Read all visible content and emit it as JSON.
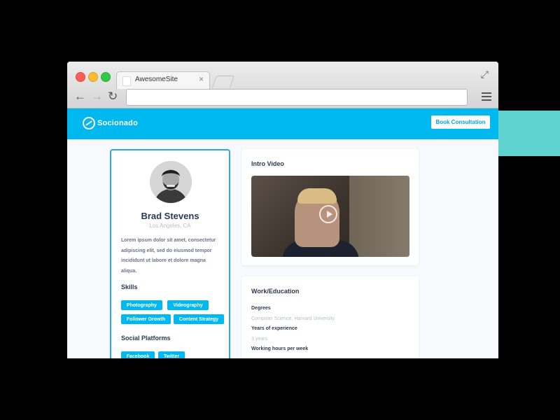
{
  "browser": {
    "tab_title": "AwesomeSite",
    "tab_close": "×",
    "address": ""
  },
  "header": {
    "brand": "Socionado",
    "cta": "Book Consultation",
    "bg_color": "#00b8f0"
  },
  "profile": {
    "name": "Brad Stevens",
    "location": "Los Angeles, CA",
    "bio": "Lorem ipsum dolor sit amet, consectetur adipiscing elit, sed do eiusmod tempor incididunt ut labore et dolore magna aliqua.",
    "skills_heading": "Skills",
    "skills": [
      "Photography",
      "Videography",
      "Follower Growth",
      "Content Strategy"
    ],
    "social_heading": "Social Platforms",
    "social": [
      "Facebook",
      "Twitter"
    ]
  },
  "video": {
    "heading": "Intro Video"
  },
  "work": {
    "heading": "Work/Education",
    "degrees_label": "Degrees",
    "degrees_value": "Computer Science, Harvard University",
    "experience_label": "Years of experience",
    "experience_value": "3 years",
    "hours_label": "Working hours per week"
  },
  "colors": {
    "accent": "#00b8f0",
    "teal_deco": "#5fd3cf"
  }
}
